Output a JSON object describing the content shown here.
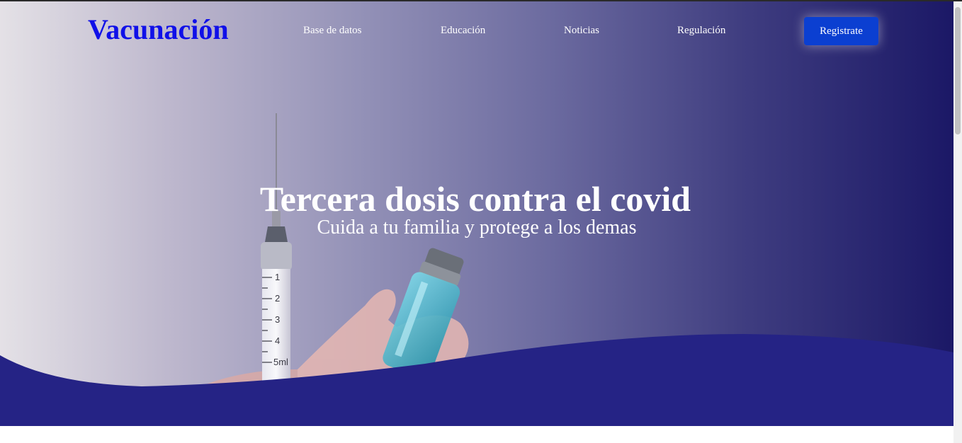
{
  "brand": {
    "name": "Vacunación"
  },
  "nav": {
    "items": [
      {
        "label": "Base de datos"
      },
      {
        "label": "Educación"
      },
      {
        "label": "Noticias"
      },
      {
        "label": "Regulación"
      }
    ],
    "cta_label": "Registrate"
  },
  "hero": {
    "title": "Tercera dosis contra el covid",
    "subtitle": "Cuida a tu familia y protege a los demas"
  },
  "syringe": {
    "marks": [
      "1",
      "2",
      "3",
      "4",
      "5ml"
    ]
  },
  "colors": {
    "brand": "#1010e8",
    "wave": "#252385",
    "button": "#0b3fd1",
    "gradient_dark": "#1b1866"
  },
  "icons": [
    "syringe-image",
    "vaccine-vial-image"
  ]
}
